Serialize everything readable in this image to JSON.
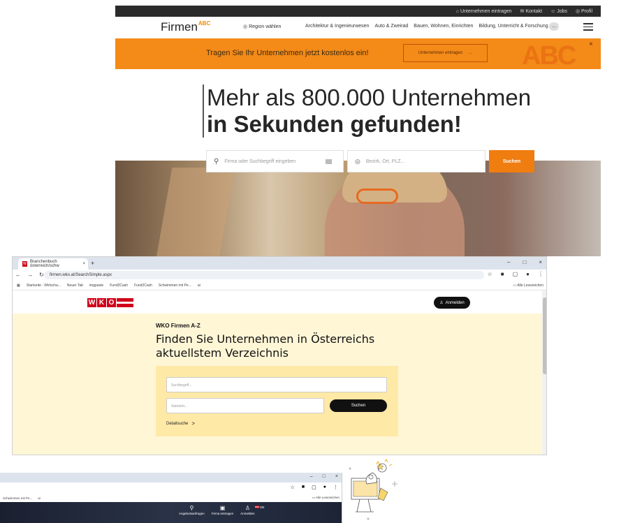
{
  "firmenabc": {
    "topbar": {
      "items": [
        "Unternehmen eintragen",
        "Kontakt",
        "Jobs",
        "Profil"
      ]
    },
    "logo_text": "Firmen",
    "logo_super": "ABC",
    "region_label": "Region wählen",
    "categories": [
      "Architektur & Ingenieurwesen",
      "Auto & Zweirad",
      "Bauen, Wohnen, Einrichten",
      "Bildung, Unterricht & Forschung"
    ],
    "more_label": "...",
    "banner": {
      "text": "Tragen Sie Ihr Unternehmen jetzt kostenlos ein!",
      "button": "Unternehmen eintragen",
      "arrow": "→",
      "abc": "ABC",
      "close": "×"
    },
    "hero": {
      "line1": "Mehr als 800.000 Unternehmen",
      "line2": "in Sekunden gefunden!"
    },
    "search": {
      "what_placeholder": "Firma oder Suchbegriff eingeben",
      "where_placeholder": "Bezirk, Ort, PLZ...",
      "button": "Suchen"
    }
  },
  "wko_browser": {
    "tab_title": "Branchenbuch österreich/schw",
    "tab_favicon": "W",
    "new_tab": "+",
    "window_controls": [
      "–",
      "□",
      "×"
    ],
    "url": "firmen.wko.at/SearchSimple.aspx",
    "bookmarks": [
      "Startseite - Wirtscha...",
      "Neuer Tab",
      "imgpaste",
      "Fund2Cash",
      "Fund2Cash",
      "Schwimmen mit Pe...",
      "ai"
    ],
    "all_bookmarks": "Alle Lesezeichen",
    "site": {
      "logo_letters": [
        "W",
        "K",
        "O"
      ],
      "login_button": "Anmelden",
      "kicker": "WKO Firmen A-Z",
      "headline_line1": "Finden Sie Unternehmen in Österreichs",
      "headline_line2": "aktuellstem Verzeichnis",
      "search_placeholder": "Suchbegriff...",
      "location_placeholder": "Standort...",
      "search_button": "Suchen",
      "detail_link": "Detailsuche",
      "detail_arrow": ">"
    }
  },
  "bottom_browser": {
    "window_controls": [
      "–",
      "□",
      "×"
    ],
    "bookmarks": [
      "Schwimmen mit Pe...",
      "ai"
    ],
    "all_bookmarks": "Alle Lesezeichen",
    "nav": [
      {
        "icon": "⚲",
        "label": "Angebotsanfragen"
      },
      {
        "icon": "▣",
        "label": "Firma eintragen"
      },
      {
        "icon": "♙",
        "label": "Anmelden"
      }
    ],
    "lang": "DE"
  },
  "colors": {
    "firmen_orange": "#f48a18",
    "firmen_button": "#f07d10",
    "wko_red": "#d0021b",
    "wko_yellow": "#fff6d6"
  }
}
